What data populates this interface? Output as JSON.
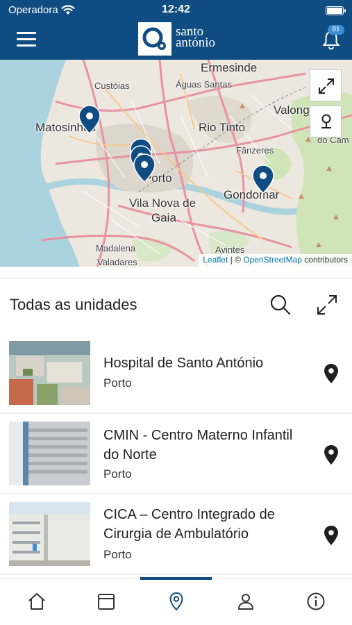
{
  "status_bar": {
    "carrier": "Operadora",
    "time": "12:42"
  },
  "header": {
    "logo_line1": "santo",
    "logo_line2": "antónio",
    "notification_count": "81",
    "brand_color": "#0f4c81"
  },
  "map": {
    "labels": {
      "ermesinde": "Ermesinde",
      "custoias": "Custóias",
      "aguas_santas": "Águas Santas",
      "valongo": "Valong",
      "matosinhos": "Matosinhos",
      "rio_tinto": "Rio Tinto",
      "fanzeres": "Fânzeres",
      "porto": "Porto",
      "gondomar": "Gondomar",
      "vila_nova": "Vila Nova de",
      "gaia": "Gaia",
      "madalena": "Madalena",
      "avintes": "Avintes",
      "valadares": "Valadares",
      "do_cam": "do Cam"
    },
    "attribution": {
      "leaflet": "Leaflet",
      "separator": " | © ",
      "osm": "OpenStreetMap",
      "suffix": " contributors"
    },
    "marker_color": "#0f4c81"
  },
  "section": {
    "title": "Todas as unidades"
  },
  "units": [
    {
      "name": "Hospital de Santo António",
      "city": "Porto"
    },
    {
      "name": "CMIN - Centro Materno Infantil do Norte",
      "city": "Porto"
    },
    {
      "name": "CICA – Centro Integrado de Cirurgia de Ambulatório",
      "city": "Porto"
    }
  ],
  "tabbar": {
    "tabs": [
      "home-icon",
      "calendar-icon",
      "location-icon",
      "profile-icon",
      "info-icon"
    ],
    "active_index": 2
  }
}
